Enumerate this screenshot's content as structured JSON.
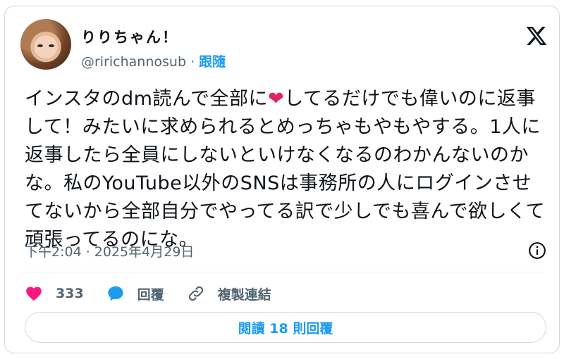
{
  "author": {
    "display_name": "りりちゃん！",
    "handle": "@ririchannosub",
    "separator": "·",
    "follow_label": "跟隨"
  },
  "tweet": {
    "text_before_heart": "インスタのdm読んで全部に",
    "heart_emoji": "❤",
    "text_after_heart": "してるだけでも偉いのに返事して！みたいに求められるとめっちゃもやもやする。1人に返事したら全員にしないといけなくなるのわかんないのかな。私のYouTube以外のSNSは事務所の人にログインさせてないから全部自分でやってる訳で少しでも喜んで欲しくて頑張ってるのにな。"
  },
  "meta": {
    "timestamp": "下午2:04 · 2025年4月29日"
  },
  "actions": {
    "like_count": "333",
    "reply_label": "回覆",
    "copy_link_label": "複製連結"
  },
  "footer": {
    "read_replies_label": "閱讀 18 則回覆"
  },
  "colors": {
    "accent": "#1d9bf0",
    "like": "#f91880",
    "muted_text": "#536471",
    "border": "#cfd9de"
  },
  "icons": [
    "x-logo-icon",
    "info-icon",
    "heart-icon",
    "reply-bubble-icon",
    "link-icon"
  ]
}
